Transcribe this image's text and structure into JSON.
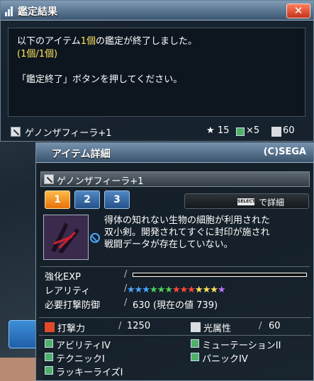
{
  "result_window": {
    "title": "鑑定結果",
    "close_label": "✕",
    "message": {
      "line1_pre": "以下のアイテム",
      "line1_count": "1個",
      "line1_post": "の鑑定が終了しました。",
      "line2": "(1個/1個)",
      "line3": "「鑑定終了」ボタンを押してください。"
    },
    "item": {
      "name": "ゲノンザフィーラ+1",
      "rarity_value": "15",
      "slots_value": "×5",
      "level_value": "60"
    }
  },
  "detail_window": {
    "title": "アイテム詳細",
    "copyright": "(C)SEGA",
    "item_name": "ゲノンザフィーラ+1",
    "tabs": [
      "1",
      "2",
      "3"
    ],
    "select_badge": "SELECT",
    "detail_label": "で詳細",
    "description": [
      "得体の知れない生物の細胞が利用された",
      "双小剣。開発されてすぐに封印が施され",
      "戦闘データが存在していない。"
    ],
    "enhance_exp_label": "強化EXP",
    "rarity_label": "レアリティ",
    "rarity_stars": 13,
    "required_label": "必要打撃防御",
    "required_value": "630 (現在の値 739)",
    "attack_label": "打撃力",
    "attack_value": "1250",
    "element_label": "光属性",
    "element_value": "60",
    "abilities": [
      "アビリティIV",
      "ミューテーションII",
      "テクニックI",
      "パニックIV",
      "ラッキーライズI"
    ]
  },
  "colors": {
    "accent": "#ffe45a",
    "close": "#c4321c",
    "tab_active": "#e6720a",
    "tab_inactive": "#25528a"
  }
}
